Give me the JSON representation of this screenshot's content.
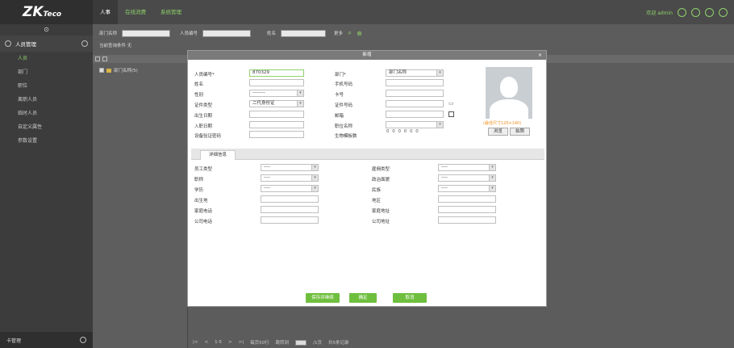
{
  "app": {
    "logo": "ZK",
    "logo_sub": "Teco",
    "tabs": [
      "人事",
      "在线消费",
      "系统管理"
    ],
    "welcome": "欢迎 admin"
  },
  "sidebar": {
    "header": "人员管理",
    "items": [
      "人员",
      "部门",
      "职位",
      "离职人员",
      "临时人员",
      "自定义属性",
      "参数设置"
    ],
    "bottom": "卡管理"
  },
  "filter": {
    "dept_name": "部门名称",
    "person_no": "人员编号",
    "name": "姓名",
    "more": "更多",
    "current_query_label": "当前查询条件",
    "current_query_value": "无"
  },
  "tree": {
    "root": "部门名称(5)"
  },
  "pager": {
    "range": "1-5",
    "per_page": "每页50行",
    "jump_label": "跳转到",
    "jump_value": "1",
    "page_unit": "/1页",
    "total": "共5条记录"
  },
  "dialog": {
    "title": "新增",
    "fields": {
      "person_no_label": "人员编号*",
      "person_no_value": "870329",
      "dept_label": "部门*",
      "dept_value": "部门名称",
      "name_label": "姓名",
      "mobile_label": "手机号码",
      "gender_label": "性别",
      "gender_value": "--------",
      "card_label": "卡号",
      "id_type_label": "证件类型",
      "id_type_value": "二代身份证",
      "id_no_label": "证件号码",
      "birth_label": "出生日期",
      "email_label": "邮箱",
      "hire_label": "入职日期",
      "position_label": "职位名称",
      "device_pwd_label": "设备验证密码",
      "bio_label": "生物模板数",
      "bio_counts": "0  0  0  0  0  0"
    },
    "photo_note": "(最佳尺寸120×140)",
    "browse_button": "浏览",
    "capture_button": "拍照",
    "section_tab": "详细信息",
    "detail": {
      "emp_type_label": "员工类型",
      "emp_type_value": "----",
      "hire_type_label": "雇佣类型",
      "hire_type_value": "----",
      "title_label": "职称",
      "title_value": "----",
      "politics_label": "政治面貌",
      "politics_value": "----",
      "edu_label": "学历",
      "edu_value": "----",
      "nation_label": "民族",
      "nation_value": "----",
      "birthplace_label": "出生地",
      "region_label": "地区",
      "home_phone_label": "家庭电话",
      "home_addr_label": "家庭地址",
      "office_phone_label": "公司电话",
      "office_addr_label": "公司地址"
    },
    "buttons": {
      "save_continue": "保存并继续",
      "ok": "确定",
      "cancel": "取消"
    }
  }
}
